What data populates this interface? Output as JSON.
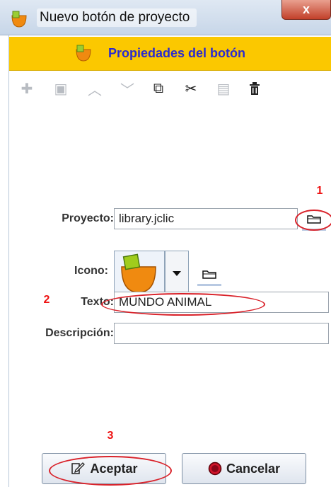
{
  "window": {
    "title": "Nuevo botón de proyecto",
    "close_label": "x"
  },
  "header": {
    "title": "Propiedades del botón"
  },
  "toolbar": {
    "items": [
      {
        "name": "add-icon",
        "enabled": false,
        "glyph": "✚"
      },
      {
        "name": "folder-add-icon",
        "enabled": false,
        "glyph": "▣"
      },
      {
        "name": "up-icon",
        "enabled": false,
        "glyph": "︿"
      },
      {
        "name": "down-icon",
        "enabled": false,
        "glyph": "﹀"
      },
      {
        "name": "copy-icon",
        "enabled": true,
        "glyph": "⧉"
      },
      {
        "name": "cut-icon",
        "enabled": true,
        "glyph": "✂"
      },
      {
        "name": "paste-icon",
        "enabled": false,
        "glyph": "▤"
      },
      {
        "name": "delete-icon",
        "enabled": true,
        "glyph": "🗑"
      }
    ]
  },
  "form": {
    "project_label": "Proyecto:",
    "project_value": "library.jclic",
    "icon_label": "Icono:",
    "text_label": "Texto:",
    "text_value": "MUNDO ANIMAL",
    "description_label": "Descripción:",
    "description_value": ""
  },
  "annotations": {
    "n1": "1",
    "n2": "2",
    "n3": "3"
  },
  "buttons": {
    "accept": "Aceptar",
    "cancel": "Cancelar"
  },
  "colors": {
    "header_bg": "#fbc800",
    "header_text": "#2a2ad0",
    "annotation": "#e11"
  }
}
